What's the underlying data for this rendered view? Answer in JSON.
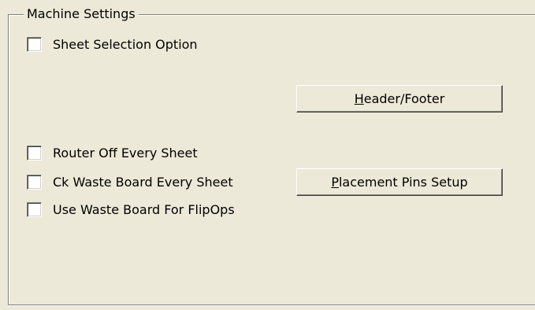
{
  "group": {
    "legend": "Machine Settings"
  },
  "checkboxes": {
    "sheet_selection": {
      "label": "Sheet Selection Option",
      "checked": false
    },
    "router_off": {
      "label": "Router Off Every Sheet",
      "checked": false
    },
    "ck_waste_board": {
      "label": "Ck Waste Board Every Sheet",
      "checked": false
    },
    "use_waste_board": {
      "label": "Use Waste Board For FlipOps",
      "checked": false
    }
  },
  "buttons": {
    "header_footer": {
      "mnemonic": "H",
      "rest": "eader/Footer"
    },
    "placement_pins": {
      "mnemonic": "P",
      "rest": "lacement Pins Setup"
    }
  }
}
